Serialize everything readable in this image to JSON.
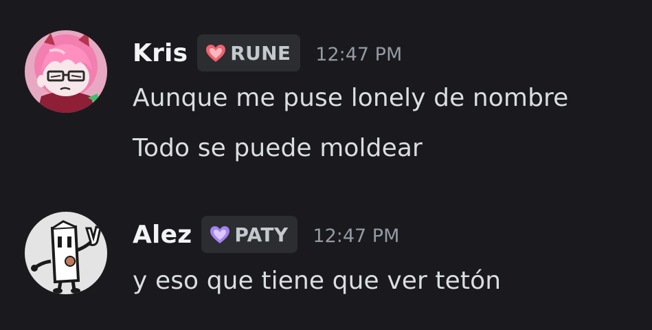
{
  "messages": [
    {
      "author": "Kris",
      "role": {
        "name": "RUNE",
        "color": "#f1616f",
        "icon": "heart-icon"
      },
      "timestamp": "12:47 PM",
      "lines": [
        "Aunque me puse lonely de nombre",
        "Todo se puede moldear"
      ],
      "avatar": "pink-haired-character-avatar"
    },
    {
      "author": "Alez",
      "role": {
        "name": "PATY",
        "color": "#a682ef",
        "icon": "heart-icon"
      },
      "timestamp": "12:47 PM",
      "lines": [
        "y eso que tiene que ver tetón"
      ],
      "avatar": "paper-character-avatar"
    }
  ],
  "theme": {
    "background": "#1a1a1e",
    "username_color": "#f2f3f5",
    "text_color": "#dbdee1",
    "timestamp_color": "#949ba4",
    "tag_background": "#2b2d31"
  }
}
